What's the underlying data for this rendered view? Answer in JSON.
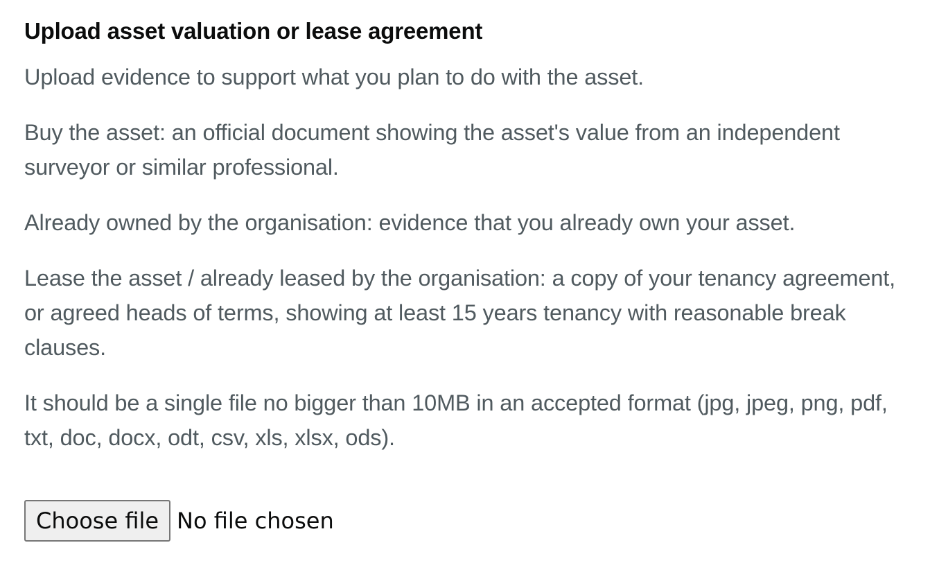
{
  "upload": {
    "label": "Upload asset valuation or lease agreement",
    "hints": [
      "Upload evidence to support what you plan to do with the asset.",
      "Buy the asset: an official document showing the asset's value from an independent surveyor or similar professional.",
      "Already owned by the organisation: evidence that you already own your asset.",
      "Lease the asset / already leased by the organisation: a copy of your tenancy agreement, or agreed heads of terms, showing at least 15 years tenancy with reasonable break clauses.",
      "It should be a single file no bigger than 10MB in an accepted format (jpg, jpeg, png, pdf, txt, doc, docx, odt, csv, xls, xlsx, ods)."
    ],
    "file_input": {
      "button_label": "Choose file",
      "status": "No file chosen"
    }
  }
}
